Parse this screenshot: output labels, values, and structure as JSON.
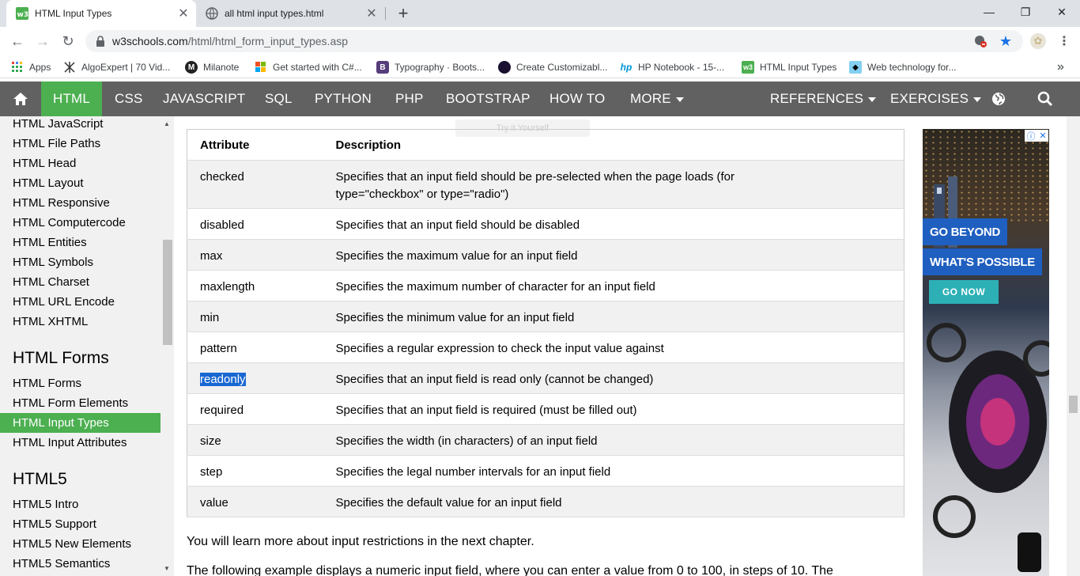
{
  "browser": {
    "tabs": [
      {
        "title": "HTML Input Types",
        "favicon": "w3schools-favicon",
        "active": true
      },
      {
        "title": "all html input types.html",
        "favicon": "globe-icon",
        "active": false
      }
    ],
    "url_host": "w3schools.com",
    "url_path": "/html/html_form_input_types.asp",
    "bookmarks": [
      {
        "label": "Apps",
        "icon": "apps-grid-icon"
      },
      {
        "label": "AlgoExpert | 70 Vid...",
        "icon": "algoexpert-icon"
      },
      {
        "label": "Milanote",
        "icon": "milanote-icon"
      },
      {
        "label": "Get started with C#...",
        "icon": "microsoft-icon"
      },
      {
        "label": "Typography · Boots...",
        "icon": "bootstrap-icon"
      },
      {
        "label": "Create Customizabl...",
        "icon": "circle-icon"
      },
      {
        "label": "HP Notebook - 15-...",
        "icon": "hp-icon"
      },
      {
        "label": "HTML Input Types",
        "icon": "w3schools-favicon"
      },
      {
        "label": "Web technology for...",
        "icon": "mdn-icon"
      }
    ],
    "bookmarks_overflow": "»"
  },
  "nav": {
    "items": [
      "HTML",
      "CSS",
      "JAVASCRIPT",
      "SQL",
      "PYTHON",
      "PHP",
      "BOOTSTRAP",
      "HOW TO",
      "MORE"
    ],
    "right_items": [
      "REFERENCES",
      "EXERCISES"
    ],
    "accent": "#4caf50",
    "bar_color": "#616161"
  },
  "sidebar": {
    "links_top": [
      "HTML JavaScript",
      "HTML File Paths",
      "HTML Head",
      "HTML Layout",
      "HTML Responsive",
      "HTML Computercode",
      "HTML Entities",
      "HTML Symbols",
      "HTML Charset",
      "HTML URL Encode",
      "HTML XHTML"
    ],
    "forms_heading": "HTML Forms",
    "forms_links": [
      "HTML Forms",
      "HTML Form Elements",
      "HTML Input Types",
      "HTML Input Attributes"
    ],
    "html5_heading": "HTML5",
    "html5_links": [
      "HTML5 Intro",
      "HTML5 Support",
      "HTML5 New Elements",
      "HTML5 Semantics"
    ]
  },
  "main": {
    "faded_button": "Try it Yourself",
    "table": {
      "headers": [
        "Attribute",
        "Description"
      ],
      "rows": [
        {
          "attr": "checked",
          "desc": "Specifies that an input field should be pre-selected when the page loads (for",
          "desc2": "type=\"checkbox\" or type=\"radio\")"
        },
        {
          "attr": "disabled",
          "desc": "Specifies that an input field should be disabled"
        },
        {
          "attr": "max",
          "desc": "Specifies the maximum value for an input field"
        },
        {
          "attr": "maxlength",
          "desc": "Specifies the maximum number of character for an input field"
        },
        {
          "attr": "min",
          "desc": "Specifies the minimum value for an input field"
        },
        {
          "attr": "pattern",
          "desc": "Specifies a regular expression to check the input value against"
        },
        {
          "attr": "readonly",
          "desc": "Specifies that an input field is read only (cannot be changed)"
        },
        {
          "attr": "required",
          "desc": "Specifies that an input field is required (must be filled out)"
        },
        {
          "attr": "size",
          "desc": "Specifies the width (in characters) of an input field"
        },
        {
          "attr": "step",
          "desc": "Specifies the legal number intervals for an input field"
        },
        {
          "attr": "value",
          "desc": "Specifies the default value for an input field"
        }
      ]
    },
    "para1": "You will learn more about input restrictions in the next chapter.",
    "para2": "The following example displays a numeric input field, where you can enter a value from 0 to 100, in steps of 10. The"
  },
  "ad": {
    "line1": "GO BEYOND",
    "line2": "WHAT'S POSSIBLE",
    "cta": "GO NOW"
  }
}
